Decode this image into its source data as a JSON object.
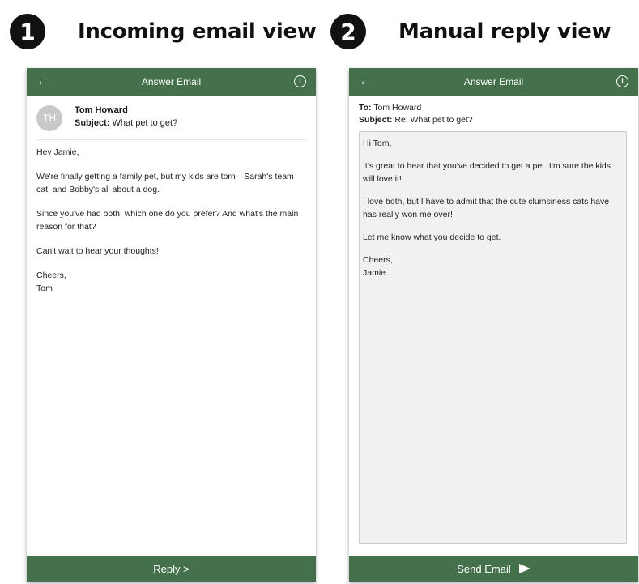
{
  "sections": [
    {
      "step": "1",
      "title": "Incoming email view"
    },
    {
      "step": "2",
      "title": "Manual reply view"
    }
  ],
  "incoming": {
    "appbar_title": "Answer Email",
    "back_glyph": "←",
    "info_glyph": "i",
    "avatar_initials": "TH",
    "sender_name": "Tom Howard",
    "subject_label": "Subject:",
    "subject_value": "What pet to get?",
    "body": {
      "greeting": "Hey Jamie,",
      "p1_line1": "We're finally getting a family pet, but my kids are torn—Sarah's team",
      "p1_line2": "cat, and Bobby's all about a dog.",
      "p2_line1": "Since you've had both, which one do you prefer? And what's the main",
      "p2_line2": "reason for that?",
      "p3": "Can't wait to hear your thoughts!",
      "signoff": "Cheers,",
      "signature": "Tom"
    },
    "reply_button": "Reply >"
  },
  "reply": {
    "appbar_title": "Answer Email",
    "back_glyph": "←",
    "info_glyph": "i",
    "to_label": "To:",
    "to_value": "Tom Howard",
    "subject_label": "Subject:",
    "subject_value": "Re: What pet to get?",
    "body": {
      "greeting": "Hi Tom,",
      "p1_line1": "It's great to hear that you've decided to get a pet. I'm sure the kids",
      "p1_line2": "will love it!",
      "p2_line1": "I love both, but I have to admit that the cute clumsiness cats have",
      "p2_line2": "has really won me over!",
      "p3": "Let me know what you decide to get.",
      "signoff": "Cheers,",
      "signature": "Jamie"
    },
    "send_button": "Send Email"
  },
  "colors": {
    "brand_green": "#44714b",
    "badge_black": "#111111",
    "textarea_bg": "#f0f1f0",
    "avatar_gray": "#c9c9c9"
  },
  "icons": [
    "back-arrow-icon",
    "info-icon",
    "send-icon"
  ]
}
